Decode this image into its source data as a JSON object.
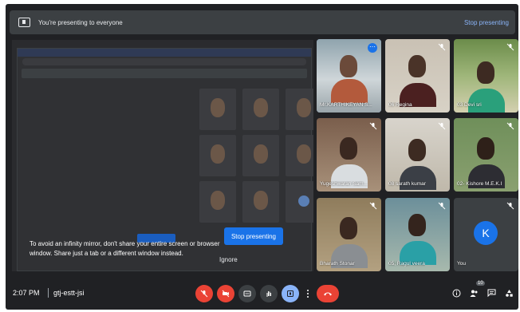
{
  "banner": {
    "text": "You're presenting to everyone",
    "stop_link": "Stop presenting"
  },
  "presentation": {
    "warning": "To avoid an infinity mirror, don't share your entire screen or browser window. Share just a tab or a different window instead.",
    "stop_button": "Stop presenting",
    "ignore_button": "Ignore"
  },
  "participants": [
    {
      "name": "Mr.KARTHIKEYAN S...",
      "active": true,
      "muted": false
    },
    {
      "name": "06 Regina",
      "active": false,
      "muted": true
    },
    {
      "name": "03 Devi sri",
      "active": false,
      "muted": true
    },
    {
      "name": "Yugeshwaran Sam...",
      "active": false,
      "muted": true
    },
    {
      "name": "08 sarath kumar",
      "active": false,
      "muted": true
    },
    {
      "name": "02- Kishore M.E.K.I",
      "active": false,
      "muted": true
    },
    {
      "name": "Bharath Stonar",
      "active": false,
      "muted": true
    },
    {
      "name": "05, Ragul veera",
      "active": false,
      "muted": true
    },
    {
      "name": "You",
      "avatar_letter": "K",
      "active": false,
      "muted": true
    }
  ],
  "toolbar": {
    "time": "2:07 PM",
    "meeting_code": "gtj-estt-jsi",
    "people_count": "10"
  },
  "colors": {
    "accent": "#1a73e8",
    "danger": "#ea4335",
    "surface": "#3c4043",
    "background": "#202124"
  }
}
